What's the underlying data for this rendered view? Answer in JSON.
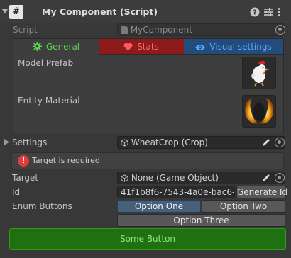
{
  "header": {
    "script_glyph": "#",
    "title": "My Component (Script)"
  },
  "script_row": {
    "label": "Script",
    "value": "MyComponent"
  },
  "tabs": [
    {
      "label": "General",
      "color": "#5bd64f",
      "icon": "gear-icon"
    },
    {
      "label": "Stats",
      "color": "#ff6a6a",
      "icon": "heart-icon"
    },
    {
      "label": "Visual settings",
      "color": "#55a9ff",
      "icon": "eye-icon"
    }
  ],
  "general": {
    "model_prefab_label": "Model Prefab",
    "entity_material_label": "Entity Material"
  },
  "settings": {
    "label": "Settings",
    "value": "WheatCrop (Crop)"
  },
  "helpbox": {
    "message": "Target is required",
    "icon_glyph": "!"
  },
  "target": {
    "label": "Target",
    "value": "None (Game Object)"
  },
  "id": {
    "label": "Id",
    "value": "41f1b8f6-7543-4a0e-bac6-",
    "button": "Generate Id"
  },
  "enum_buttons": {
    "label": "Enum Buttons",
    "options": [
      "Option One",
      "Option Two",
      "Option Three"
    ],
    "selected": "Option One"
  },
  "some_button": {
    "label": "Some Button"
  },
  "colors": {
    "accent_green": "#206f10",
    "stats_red": "#8e1b1b",
    "visual_blue": "#234b7c"
  }
}
